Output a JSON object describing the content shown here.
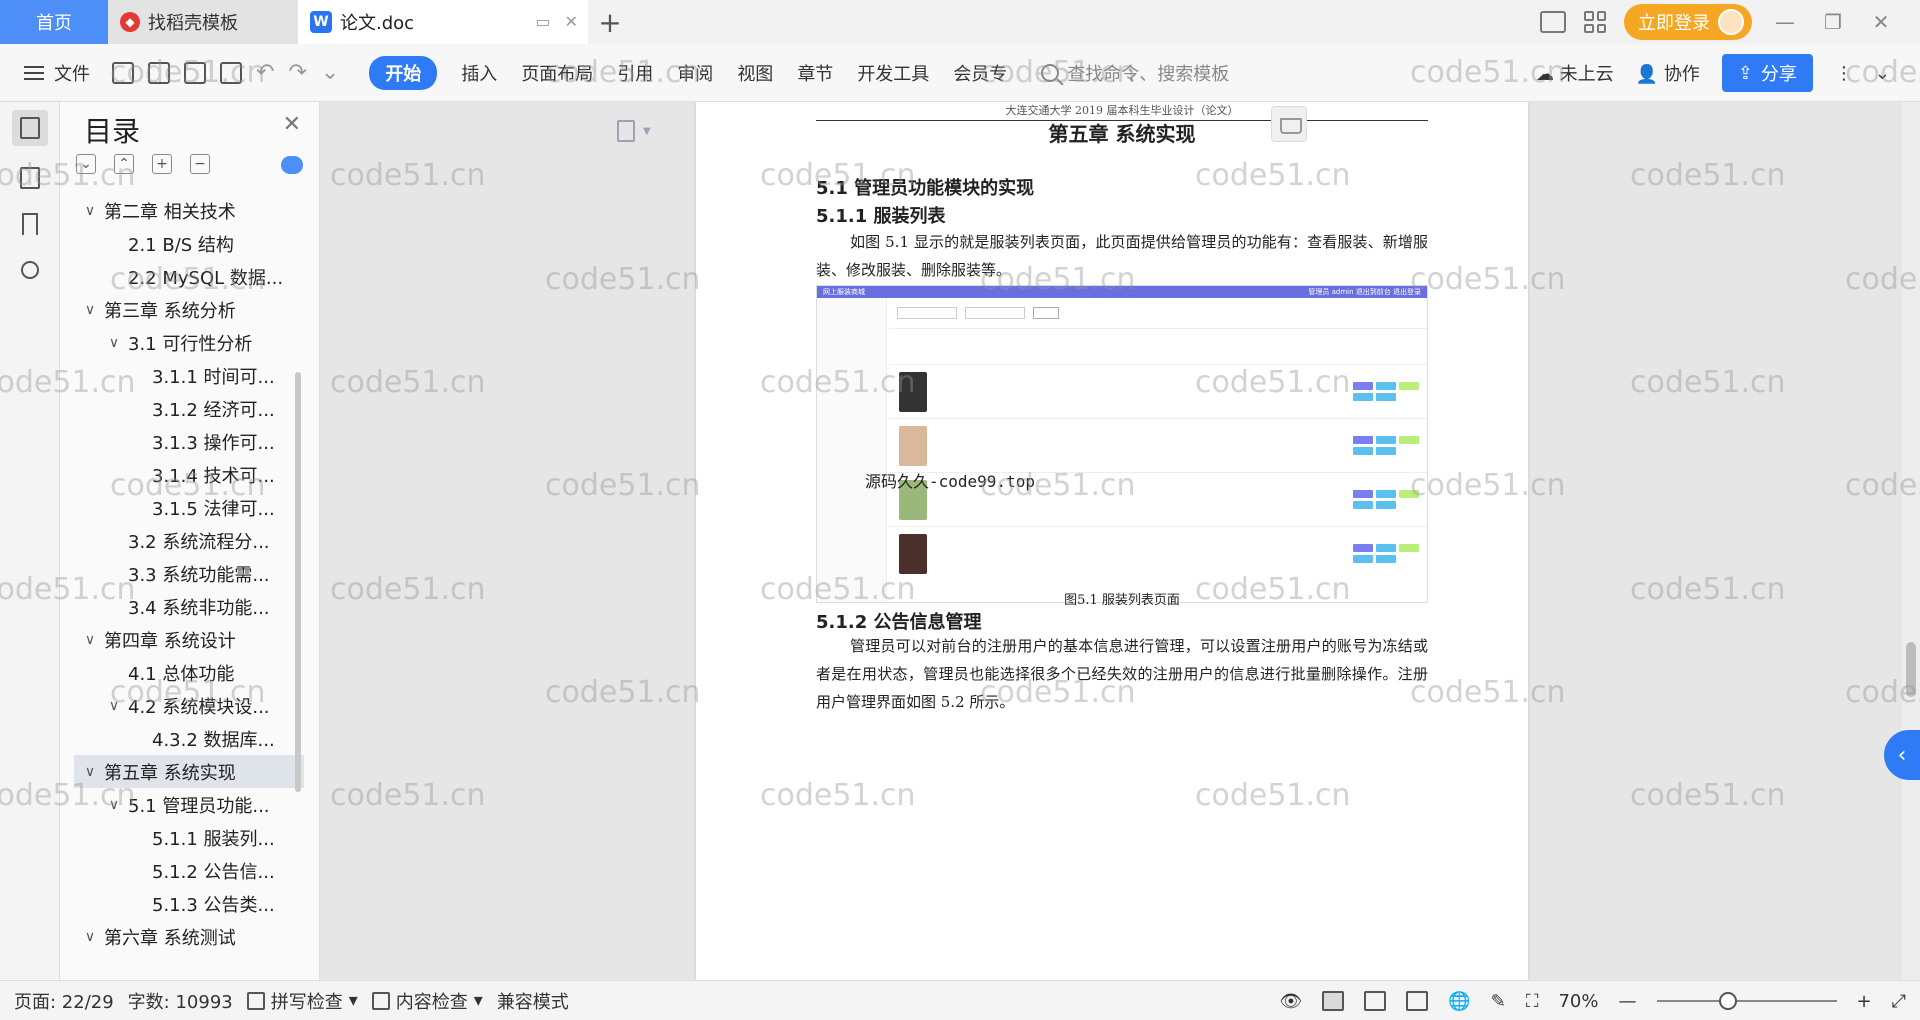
{
  "titlebar": {
    "tabs": [
      {
        "label": "首页"
      },
      {
        "label": "找稻壳模板"
      },
      {
        "label": "论文.doc"
      }
    ],
    "login_label": "立即登录"
  },
  "toolbar": {
    "file_label": "文件",
    "tabs": [
      "开始",
      "插入",
      "页面布局",
      "引用",
      "审阅",
      "视图",
      "章节",
      "开发工具",
      "会员专"
    ],
    "search_placeholder": "查找命令、搜索模板",
    "cloud_label": "未上云",
    "collab_label": "协作",
    "share_label": "分享"
  },
  "toc": {
    "title": "目录",
    "items": [
      {
        "label": "第二章 相关技术"
      },
      {
        "label": "2.1 B/S 结构"
      },
      {
        "label": "2.2 MySQL 数据..."
      },
      {
        "label": "第三章 系统分析"
      },
      {
        "label": "3.1 可行性分析"
      },
      {
        "label": "3.1.1 时间可..."
      },
      {
        "label": "3.1.2 经济可..."
      },
      {
        "label": "3.1.3 操作可..."
      },
      {
        "label": "3.1.4 技术可..."
      },
      {
        "label": "3.1.5 法律可..."
      },
      {
        "label": "3.2 系统流程分..."
      },
      {
        "label": "3.3 系统功能需..."
      },
      {
        "label": "3.4 系统非功能..."
      },
      {
        "label": "第四章 系统设计"
      },
      {
        "label": "4.1 总体功能"
      },
      {
        "label": "4.2 系统模块设..."
      },
      {
        "label": "4.3.2 数据库..."
      },
      {
        "label": "第五章 系统实现"
      },
      {
        "label": "5.1 管理员功能..."
      },
      {
        "label": "5.1.1 服装列..."
      },
      {
        "label": "5.1.2 公告信..."
      },
      {
        "label": "5.1.3 公告类..."
      },
      {
        "label": "第六章 系统测试"
      }
    ]
  },
  "document": {
    "header": "大连交通大学 2019 届本科生毕业设计（论文）",
    "chapter_title": "第五章  系统实现",
    "section_5_1": "5.1  管理员功能模块的实现",
    "section_5_1_1": "5.1.1  服装列表",
    "para_1": "如图 5.1 显示的就是服装列表页面，此页面提供给管理员的功能有：查看服装、新增服装、修改服装、删除服装等。",
    "figure": {
      "app_title": "网上服装商城",
      "app_user": "管理员 admin   退出到前台   退出登录",
      "watermark_text": "源码久久-code99.top",
      "caption": "图5.1  服装列表页面"
    },
    "section_5_1_2": "5.1.2  公告信息管理",
    "para_2": "管理员可以对前台的注册用户的基本信息进行管理，可以设置注册用户的账号为冻结或者是在用状态，管理员也能选择很多个已经失效的注册用户的信息进行批量删除操作。注册用户管理界面如图 5.2 所示。"
  },
  "watermark": "code51.cn",
  "status": {
    "page": "页面: 22/29",
    "words": "字数: 10993",
    "spellcheck": "拼写检查",
    "content_check": "内容检查",
    "compat_mode": "兼容模式",
    "zoom": "70%"
  }
}
